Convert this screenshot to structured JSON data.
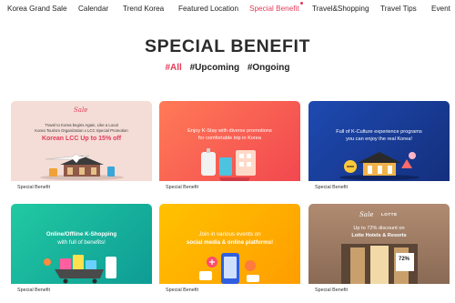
{
  "nav": {
    "items": [
      {
        "label": "Korea Grand Sale",
        "active": false
      },
      {
        "label": "Calendar",
        "active": false
      },
      {
        "label": "Trend Korea",
        "active": false
      },
      {
        "label": "Featured Location",
        "active": false
      },
      {
        "label": "Special Benefit",
        "active": true
      },
      {
        "label": "Travel&Shopping",
        "active": false
      },
      {
        "label": "Travel Tips",
        "active": false
      },
      {
        "label": "Event",
        "active": false
      }
    ]
  },
  "page": {
    "title": "SPECIAL BENEFIT",
    "filters": [
      {
        "label": "#All",
        "active": true
      },
      {
        "label": "#Upcoming",
        "active": false
      },
      {
        "label": "#Ongoing",
        "active": false
      }
    ]
  },
  "cards": [
    {
      "category": "Special Benefit",
      "logo": "Sale",
      "lines": [
        "Travel to Korea begins Again, Like a Local",
        "Korea Tourism Organization x LCC Special Promotion",
        "Korean LCC Up to 15% off"
      ]
    },
    {
      "category": "Special Benefit",
      "lines": [
        "Enjoy K-Stay with diverse promotions",
        "for comfortable trip in Korea"
      ]
    },
    {
      "category": "Special Benefit",
      "lines": [
        "Full of K-Culture experience programs",
        "you can enjoy the real Korea!"
      ]
    },
    {
      "category": "Special Benefit",
      "lines": [
        "Online/Offline K-Shopping",
        "with full of benefits!"
      ]
    },
    {
      "category": "Special Benefit",
      "lines": [
        "Join in various events on",
        "social media & online platforms!"
      ]
    },
    {
      "category": "Special Benefit",
      "logo": "Sale",
      "partner": "LOTTE",
      "badge": "72%",
      "lines": [
        "Up to 72% discount on",
        "Lotte Hotels & Resorts"
      ]
    }
  ],
  "colors": {
    "accent": "#e23b5a",
    "card1": "#f4ddd7",
    "card2": "#f2484f",
    "card3": "#1e4ab1",
    "card4": "#17b39c",
    "card5": "#ffb000",
    "card6": "#9c7a63"
  }
}
